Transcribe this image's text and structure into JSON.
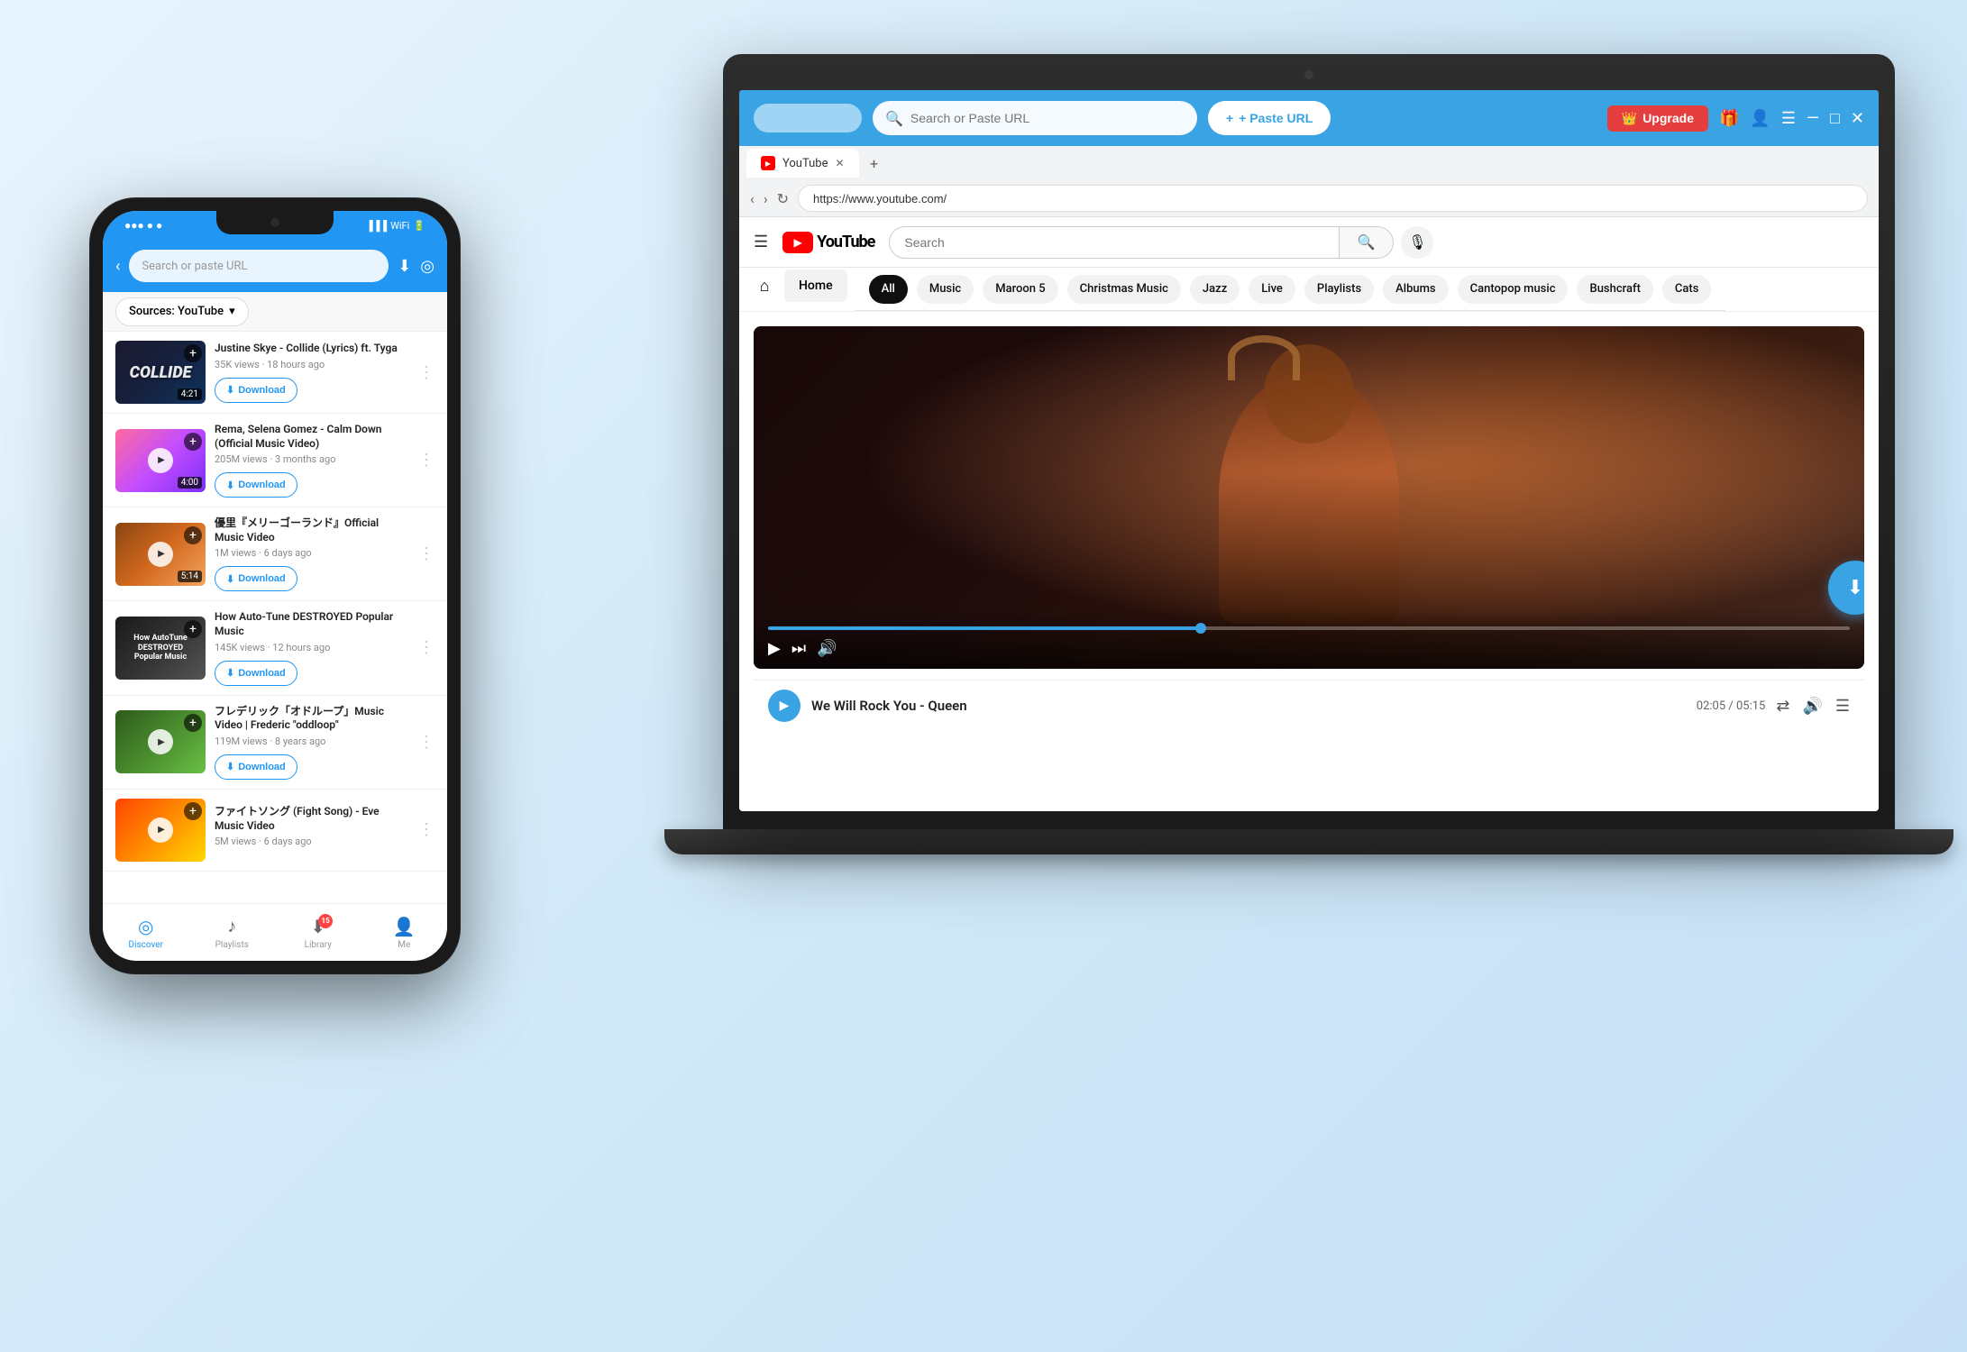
{
  "app": {
    "search_placeholder": "Search or Paste URL",
    "paste_url_label": "+ Paste URL",
    "upgrade_label": "Upgrade",
    "logo_label": ""
  },
  "browser": {
    "tab_label": "YouTube",
    "url": "https://www.youtube.com/",
    "new_tab_symbol": "+"
  },
  "youtube": {
    "search_placeholder": "Search",
    "home_label": "Home",
    "chips": [
      "All",
      "Music",
      "Maroon 5",
      "Christmas Music",
      "Jazz",
      "Live",
      "Playlists",
      "Albums",
      "Cantopop music",
      "Bushcraft",
      "Cats"
    ],
    "now_playing": {
      "title": "We Will Rock You - Queen",
      "time": "02:05 / 05:15"
    }
  },
  "phone": {
    "search_placeholder": "Search or paste URL",
    "sources_label": "Sources: YouTube",
    "videos": [
      {
        "title": "Justine Skye - Collide (Lyrics) ft. Tyga",
        "meta": "35K views · 18 hours ago",
        "duration": "4:21",
        "thumb_class": "thumb-collide",
        "thumb_text": "COLLIDE"
      },
      {
        "title": "Rema, Selena Gomez - Calm Down (Official Music Video)",
        "meta": "205M views · 3 months ago",
        "duration": "4:00",
        "thumb_class": "thumb-rema",
        "thumb_text": ""
      },
      {
        "title": "優里『メリーゴーランド』Official Music Video",
        "meta": "1M views · 6 days ago",
        "duration": "5:14",
        "thumb_class": "thumb-yuu",
        "thumb_text": ""
      },
      {
        "title": "How Auto-Tune DESTROYED Popular Music",
        "meta": "145K views · 12 hours ago",
        "duration": "",
        "thumb_class": "thumb-autotune",
        "thumb_text": "How AutoTune DESTROYED MUSIC"
      },
      {
        "title": "フレデリック「オドループ」Music Video | Frederic \"oddloop\"",
        "meta": "119M views · 8 years ago",
        "duration": "",
        "thumb_class": "thumb-frederic",
        "thumb_text": ""
      },
      {
        "title": "ファイトソング (Fight Song) - Eve Music Video",
        "meta": "5M views · 6 days ago",
        "duration": "",
        "thumb_class": "thumb-fight",
        "thumb_text": ""
      }
    ],
    "download_label": "Download",
    "nav": {
      "discover": "Discover",
      "playlists": "Playlists",
      "library": "Library",
      "me": "Me"
    },
    "library_badge": "15"
  },
  "icons": {
    "search": "🔍",
    "download": "⬇",
    "back": "‹",
    "more": "⋮",
    "crown": "👑",
    "gift": "🎁",
    "user": "👤",
    "menu": "☰",
    "minimize": "—",
    "maximize": "□",
    "close": "✕",
    "play": "▶",
    "forward": "⏭",
    "volume": "🔊",
    "shuffle": "⇄",
    "queue": "☰",
    "home": "⌂",
    "note": "♪",
    "mic": "🎙",
    "refresh": "↻",
    "chevron_down": "▾",
    "plus": "+"
  }
}
